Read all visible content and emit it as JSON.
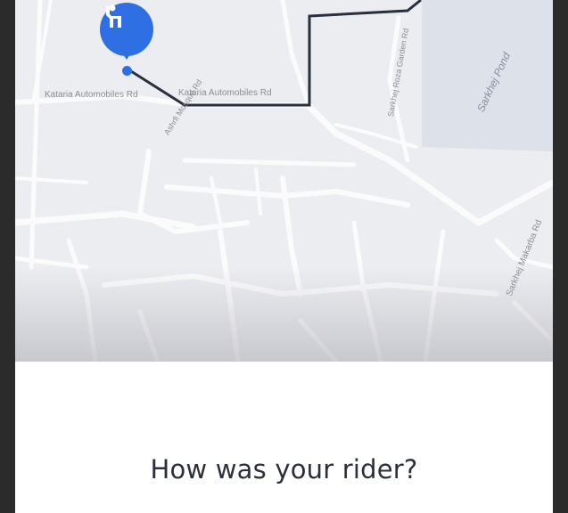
{
  "map": {
    "streets": [
      {
        "label": "Kataria Automobiles Rd"
      },
      {
        "label": "Kataria Automobiles Rd"
      },
      {
        "label": "Ashrfi Mosque Rd"
      },
      {
        "label": "Sarkhej Roza Garden Rd"
      },
      {
        "label": "Sarkhej Pond"
      },
      {
        "label": "Sarkhej Makarba Rd"
      }
    ],
    "pickup_icon": "hand-raised-person-icon",
    "accent_color": "#2f6fe4",
    "route_color": "#27303f"
  },
  "rating": {
    "question": "How was your rider?"
  }
}
